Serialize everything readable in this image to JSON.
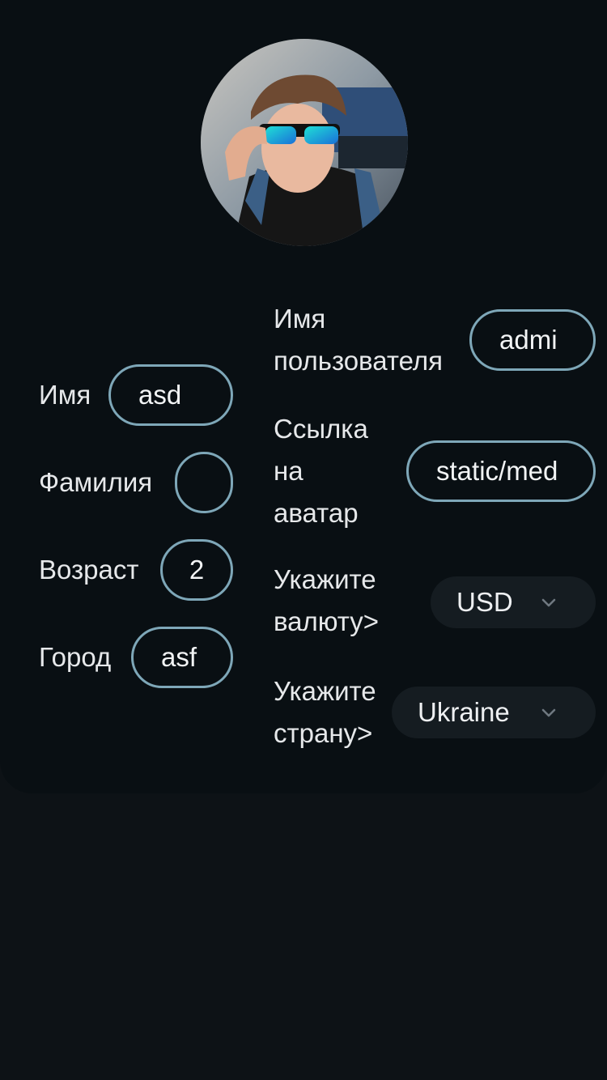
{
  "profile": {
    "avatar_alt": "avatar",
    "first_name": {
      "label": "Имя",
      "value": "asd"
    },
    "last_name": {
      "label": "Фамилия",
      "value": ""
    },
    "age": {
      "label": "Возраст",
      "value": "2"
    },
    "city": {
      "label": "Город",
      "value": "asf"
    },
    "username": {
      "label_line1": "Имя",
      "label_line2": "пользователя",
      "value": "admi"
    },
    "avatar_link": {
      "label_line1": "Ссылка",
      "label_line2": "на",
      "label_line3": "аватар",
      "value": "static/med"
    },
    "currency": {
      "label_line1": "Укажите",
      "label_line2": "валюту>",
      "value": "USD",
      "icon": "chevron-down-icon"
    },
    "country": {
      "label_line1": "Укажите",
      "label_line2": "страну>",
      "value": "Ukraine",
      "icon": "chevron-down-icon"
    }
  },
  "colors": {
    "background": "#0d1216",
    "card": "#090f13",
    "field_border": "#7ea7b8",
    "select_bg": "#151c21",
    "text": "#e6e8ea"
  }
}
